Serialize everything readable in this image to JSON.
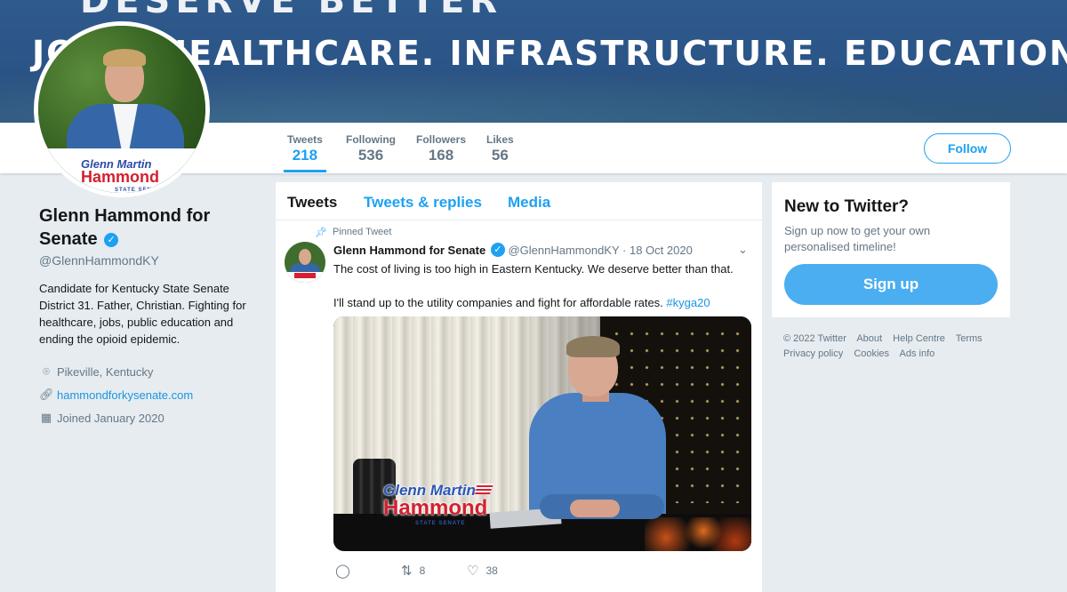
{
  "banner": {
    "top_text": "DESERVE BETTER",
    "slogan": "JOBS. HEALTHCARE. INFRASTRUCTURE. EDUCATION. WAGES."
  },
  "avatar": {
    "logo_line1": "Glenn Martin",
    "logo_line2": "Hammond",
    "logo_line3": "STATE SENATE"
  },
  "stats": [
    {
      "label": "Tweets",
      "value": "218"
    },
    {
      "label": "Following",
      "value": "536"
    },
    {
      "label": "Followers",
      "value": "168"
    },
    {
      "label": "Likes",
      "value": "56"
    }
  ],
  "follow_label": "Follow",
  "profile": {
    "name": "Glenn Hammond for Senate",
    "handle": "@GlennHammondKY",
    "bio": "Candidate for Kentucky State Senate District 31. Father, Christian. Fighting for healthcare, jobs, public education and ending the opioid epidemic.",
    "location": "Pikeville, Kentucky",
    "website": "hammondforkysenate.com",
    "joined": "Joined January 2020"
  },
  "tabs": [
    "Tweets",
    "Tweets & replies",
    "Media"
  ],
  "tweet": {
    "pinned_label": "Pinned Tweet",
    "author": "Glenn Hammond for Senate",
    "handle": "@GlennHammondKY",
    "date": "· 18 Oct 2020",
    "text1": "The cost of living is too high in Eastern Kentucky. We deserve better than that.",
    "text2": "I'll stand up to the utility companies and fight for affordable rates.",
    "hashtag": "#kyga20",
    "media_logo1": "Glenn Martin",
    "media_logo2": "Hammond",
    "media_logo3": "STATE SENATE",
    "retweets": "8",
    "likes": "38"
  },
  "widget": {
    "title": "New to Twitter?",
    "subtitle": "Sign up now to get your own personalised timeline!",
    "signup": "Sign up"
  },
  "footer": [
    "© 2022 Twitter",
    "About",
    "Help Centre",
    "Terms",
    "Privacy policy",
    "Cookies",
    "Ads info"
  ],
  "colors": {
    "accent": "#1da1f2",
    "background": "#e6ecf0",
    "brand_red": "#d4202f",
    "brand_blue": "#2a55b8"
  }
}
